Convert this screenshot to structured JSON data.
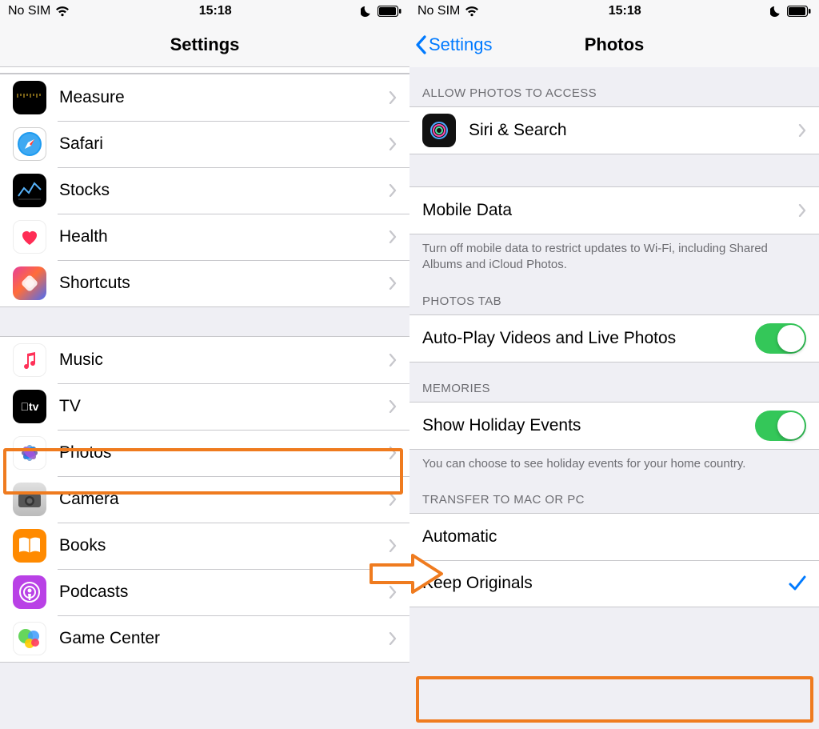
{
  "status": {
    "carrier": "No SIM",
    "time": "15:18"
  },
  "left": {
    "title": "Settings",
    "items1": [
      {
        "label": "Measure"
      },
      {
        "label": "Safari"
      },
      {
        "label": "Stocks"
      },
      {
        "label": "Health"
      },
      {
        "label": "Shortcuts"
      }
    ],
    "items2": [
      {
        "label": "Music"
      },
      {
        "label": "TV"
      },
      {
        "label": "Photos"
      },
      {
        "label": "Camera"
      },
      {
        "label": "Books"
      },
      {
        "label": "Podcasts"
      },
      {
        "label": "Game Center"
      }
    ]
  },
  "right": {
    "backLabel": "Settings",
    "title": "Photos",
    "allowHeader": "ALLOW PHOTOS TO ACCESS",
    "siri": "Siri & Search",
    "mobileData": "Mobile Data",
    "mobileDataFooter": "Turn off mobile data to restrict updates to Wi-Fi, including Shared Albums and iCloud Photos.",
    "photosTabHeader": "PHOTOS TAB",
    "autoplay": "Auto-Play Videos and Live Photos",
    "memoriesHeader": "MEMORIES",
    "holidayEvents": "Show Holiday Events",
    "holidayFooter": "You can choose to see holiday events for your home country.",
    "transferHeader": "TRANSFER TO MAC OR PC",
    "automatic": "Automatic",
    "keepOriginals": "Keep Originals"
  }
}
